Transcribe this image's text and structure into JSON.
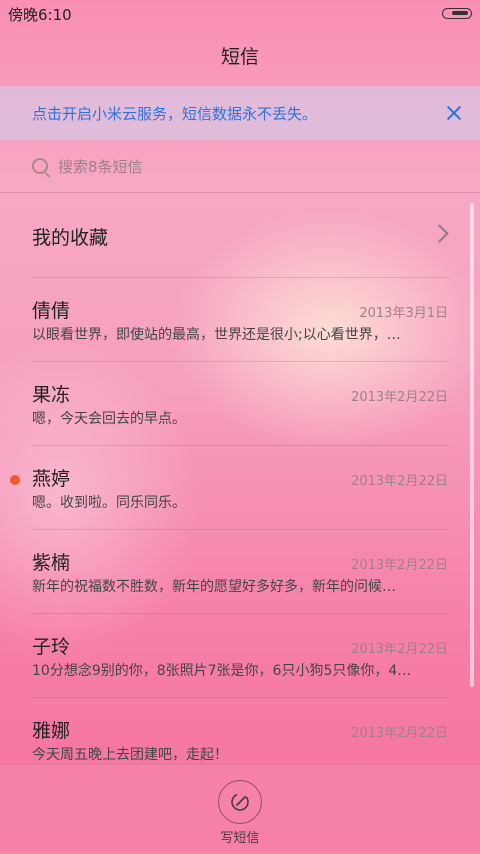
{
  "status_bar": {
    "time": "傍晚6:10"
  },
  "app": {
    "title": "短信"
  },
  "banner": {
    "text": "点击开启小米云服务，短信数据永不丢失。"
  },
  "search": {
    "placeholder": "搜索8条短信"
  },
  "favorites": {
    "label": "我的收藏"
  },
  "messages": [
    {
      "name": "倩倩",
      "date": "2013年3月1日",
      "preview": "以眼看世界，即使站的最高，世界还是很小;以心看世界，…",
      "unread": false
    },
    {
      "name": "果冻",
      "date": "2013年2月22日",
      "preview": "嗯，今天会回去的早点。",
      "unread": false
    },
    {
      "name": "燕婷",
      "date": "2013年2月22日",
      "preview": "嗯。收到啦。同乐同乐。",
      "unread": true
    },
    {
      "name": "紫楠",
      "date": "2013年2月22日",
      "preview": "新年的祝福数不胜数，新年的愿望好多好多，新年的问候…",
      "unread": false
    },
    {
      "name": "子玲",
      "date": "2013年2月22日",
      "preview": "10分想念9别的你，8张照片7张是你，6只小狗5只像你，4…",
      "unread": false
    },
    {
      "name": "雅娜",
      "date": "2013年2月22日",
      "preview": "今天周五晚上去团建吧，走起！",
      "unread": false
    }
  ],
  "compose": {
    "label": "写短信"
  },
  "colors": {
    "accent": "#2f73d8",
    "unread_dot": "#ef5a2a",
    "background": "#f69fbe"
  }
}
